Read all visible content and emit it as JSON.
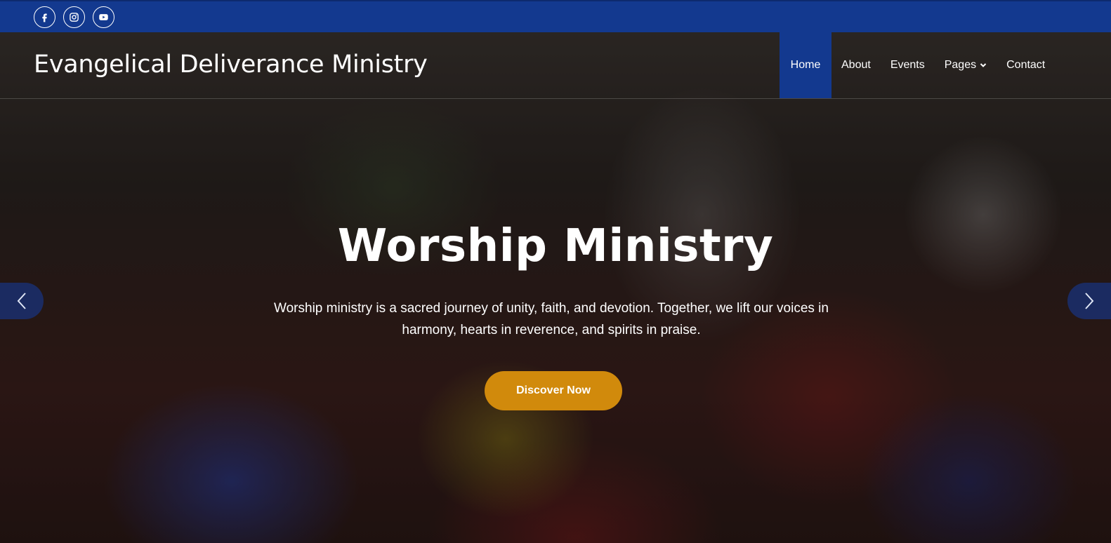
{
  "social": [
    {
      "icon": "facebook-icon"
    },
    {
      "icon": "instagram-icon"
    },
    {
      "icon": "youtube-icon"
    }
  ],
  "header": {
    "site_title": "Evangelical Deliverance Ministry"
  },
  "nav": {
    "items": [
      {
        "label": "Home",
        "active": true
      },
      {
        "label": "About",
        "active": false
      },
      {
        "label": "Events",
        "active": false
      },
      {
        "label": "Pages",
        "active": false,
        "has_dropdown": true
      },
      {
        "label": "Contact",
        "active": false
      }
    ]
  },
  "slide": {
    "title": "Worship Ministry",
    "text": "Worship ministry is a sacred journey of unity, faith, and devotion. Together, we lift our voices in harmony, hearts in reverence, and spirits in praise.",
    "cta_label": "Discover Now"
  },
  "colors": {
    "brand_blue": "#13398f",
    "cta_orange": "#d18a0c",
    "text": "#ffffff"
  }
}
